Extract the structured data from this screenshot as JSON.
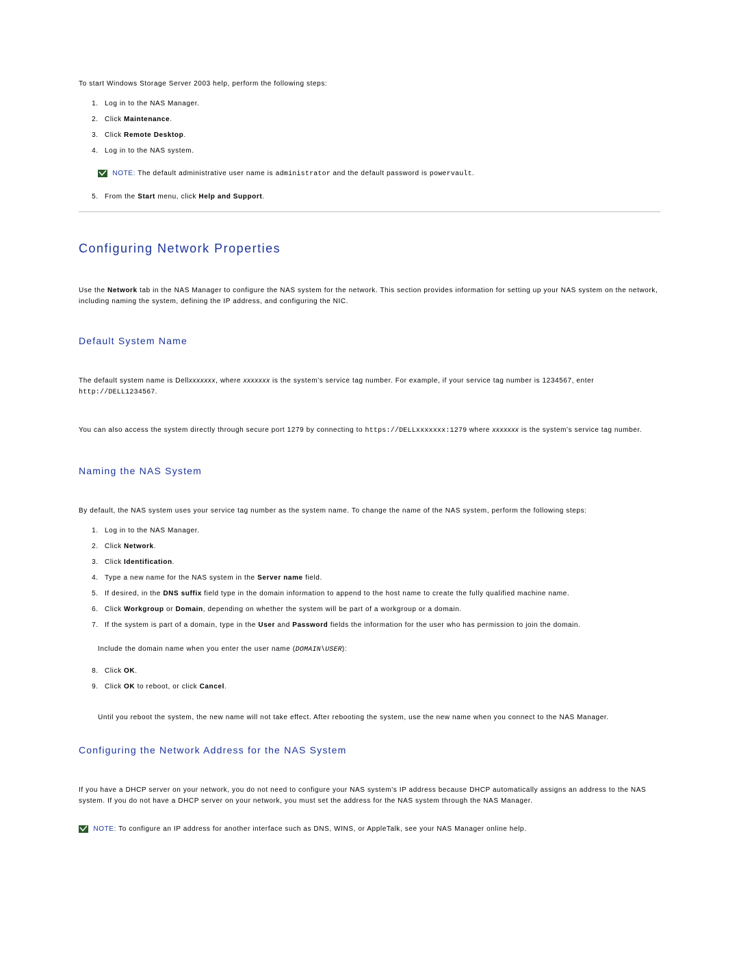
{
  "intro_top": "To start Windows Storage Server 2003 help, perform the following steps:",
  "steps_top": [
    "Log in to the NAS Manager.",
    "Click Maintenance.",
    "Click Remote Desktop.",
    "Log in to the NAS system."
  ],
  "note1": {
    "label": "NOTE:",
    "before": " The default administrative user name is ",
    "code1": "administrator",
    "mid": " and the default password is ",
    "code2": "powervault",
    "after": "."
  },
  "step5": "From the Start menu, click Help and Support.",
  "h2_config": "Configuring Network Properties",
  "config_intro": "Use the Network tab in the NAS Manager to configure the NAS system for the network. This section provides information for setting up your NAS system on the network, including naming the system, defining the IP address, and configuring the NIC.",
  "h3_default": "Default System Name",
  "default_p1": {
    "a": "The default system name is Dell",
    "i1": "xxxxxxx",
    "b": ", where ",
    "i2": "xxxxxxx",
    "c": " is the system's service tag number. For example, if your service tag number is 1234567, enter ",
    "code": "http://DELL1234567",
    "d": "."
  },
  "default_p2": {
    "a": "You can also access the system directly through secure port 1279 by connecting to ",
    "code": "https://DELLxxxxxxx:1279",
    "b": " where ",
    "i1": "xxxxxxx",
    "c": " is the system's service tag number."
  },
  "h3_naming": "Naming the NAS System",
  "naming_intro": "By default, the NAS system uses your service tag number as the system name. To change the name of the NAS system, perform the following steps:",
  "naming_steps_1_7": [
    "Log in to the NAS Manager.",
    "Click Network.",
    "Click Identification.",
    "Type a new name for the NAS system in the Server name field.",
    "If desired, in the DNS suffix field type in the domain information to append to the host name to create the fully qualified machine name.",
    "Click Workgroup or Domain, depending on whether the system will be part of a workgroup or a domain.",
    "If the system is part of a domain, type in the User and Password fields the information for the user who has permission to join the domain."
  ],
  "naming_sub": {
    "a": "Include the domain name when you enter the user name (",
    "code": "DOMAIN\\USER",
    "b": "):"
  },
  "naming_steps_8_9": [
    "Click OK.",
    "Click OK to reboot, or click Cancel."
  ],
  "naming_sub2": "Until you reboot the system, the new name will not take effect. After rebooting the system, use the new name when you connect to the NAS Manager.",
  "h3_addr": "Configuring the Network Address for the NAS System",
  "addr_intro": "If you have a DHCP server on your network, you do not need to configure your NAS system's IP address because DHCP automatically assigns an address to the NAS system. If you do not have a DHCP server on your network, you must set the address for the NAS system through the NAS Manager.",
  "note2": {
    "label": "NOTE:",
    "text": " To configure an IP address for another interface such as DNS, WINS, or AppleTalk, see your NAS Manager online help."
  }
}
